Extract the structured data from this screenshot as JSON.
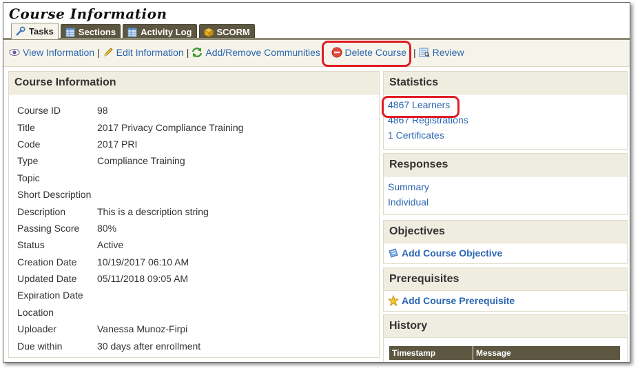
{
  "page": {
    "title": "Course Information"
  },
  "tabs": [
    {
      "label": "Tasks",
      "icon": "wrench-icon",
      "active": true
    },
    {
      "label": "Sections",
      "icon": "table-icon",
      "active": false
    },
    {
      "label": "Activity Log",
      "icon": "table-icon",
      "active": false
    },
    {
      "label": "SCORM",
      "icon": "package-icon",
      "active": false
    }
  ],
  "toolbar": {
    "view": "View Information",
    "edit": "Edit Information",
    "communities": "Add/Remove Communities",
    "delete": "Delete Course",
    "review": "Review",
    "separator": "|"
  },
  "course_info": {
    "heading": "Course Information",
    "rows": [
      {
        "label": "Course ID",
        "value": "98"
      },
      {
        "label": "Title",
        "value": "2017 Privacy Compliance Training"
      },
      {
        "label": "Code",
        "value": "2017 PRI"
      },
      {
        "label": "Type",
        "value": "Compliance Training"
      },
      {
        "label": "Topic",
        "value": ""
      },
      {
        "label": "Short Description",
        "value": ""
      },
      {
        "label": "Description",
        "value": "This is a description string"
      },
      {
        "label": "Passing Score",
        "value": "80%"
      },
      {
        "label": "Status",
        "value": "Active"
      },
      {
        "label": "Creation Date",
        "value": "10/19/2017 06:10 AM"
      },
      {
        "label": "Updated Date",
        "value": "05/11/2018 09:05 AM"
      },
      {
        "label": "Expiration Date",
        "value": ""
      },
      {
        "label": "Location",
        "value": ""
      },
      {
        "label": "Uploader",
        "value": "Vanessa Munoz-Firpi"
      },
      {
        "label": "Due within",
        "value": "30 days after enrollment"
      }
    ]
  },
  "statistics": {
    "heading": "Statistics",
    "learners": "4867 Learners",
    "registrations": "4867 Registrations",
    "certificates": "1 Certificates"
  },
  "responses": {
    "heading": "Responses",
    "summary": "Summary",
    "individual": "Individual"
  },
  "objectives": {
    "heading": "Objectives",
    "add": "Add Course Objective"
  },
  "prerequisites": {
    "heading": "Prerequisites",
    "add": "Add Course Prerequisite"
  },
  "history": {
    "heading": "History",
    "col_timestamp": "Timestamp",
    "col_message": "Message"
  },
  "colors": {
    "link": "#2b66b0",
    "tab_bg": "#5d5640",
    "panel_head": "#efece0",
    "highlight": "#e01b24"
  }
}
